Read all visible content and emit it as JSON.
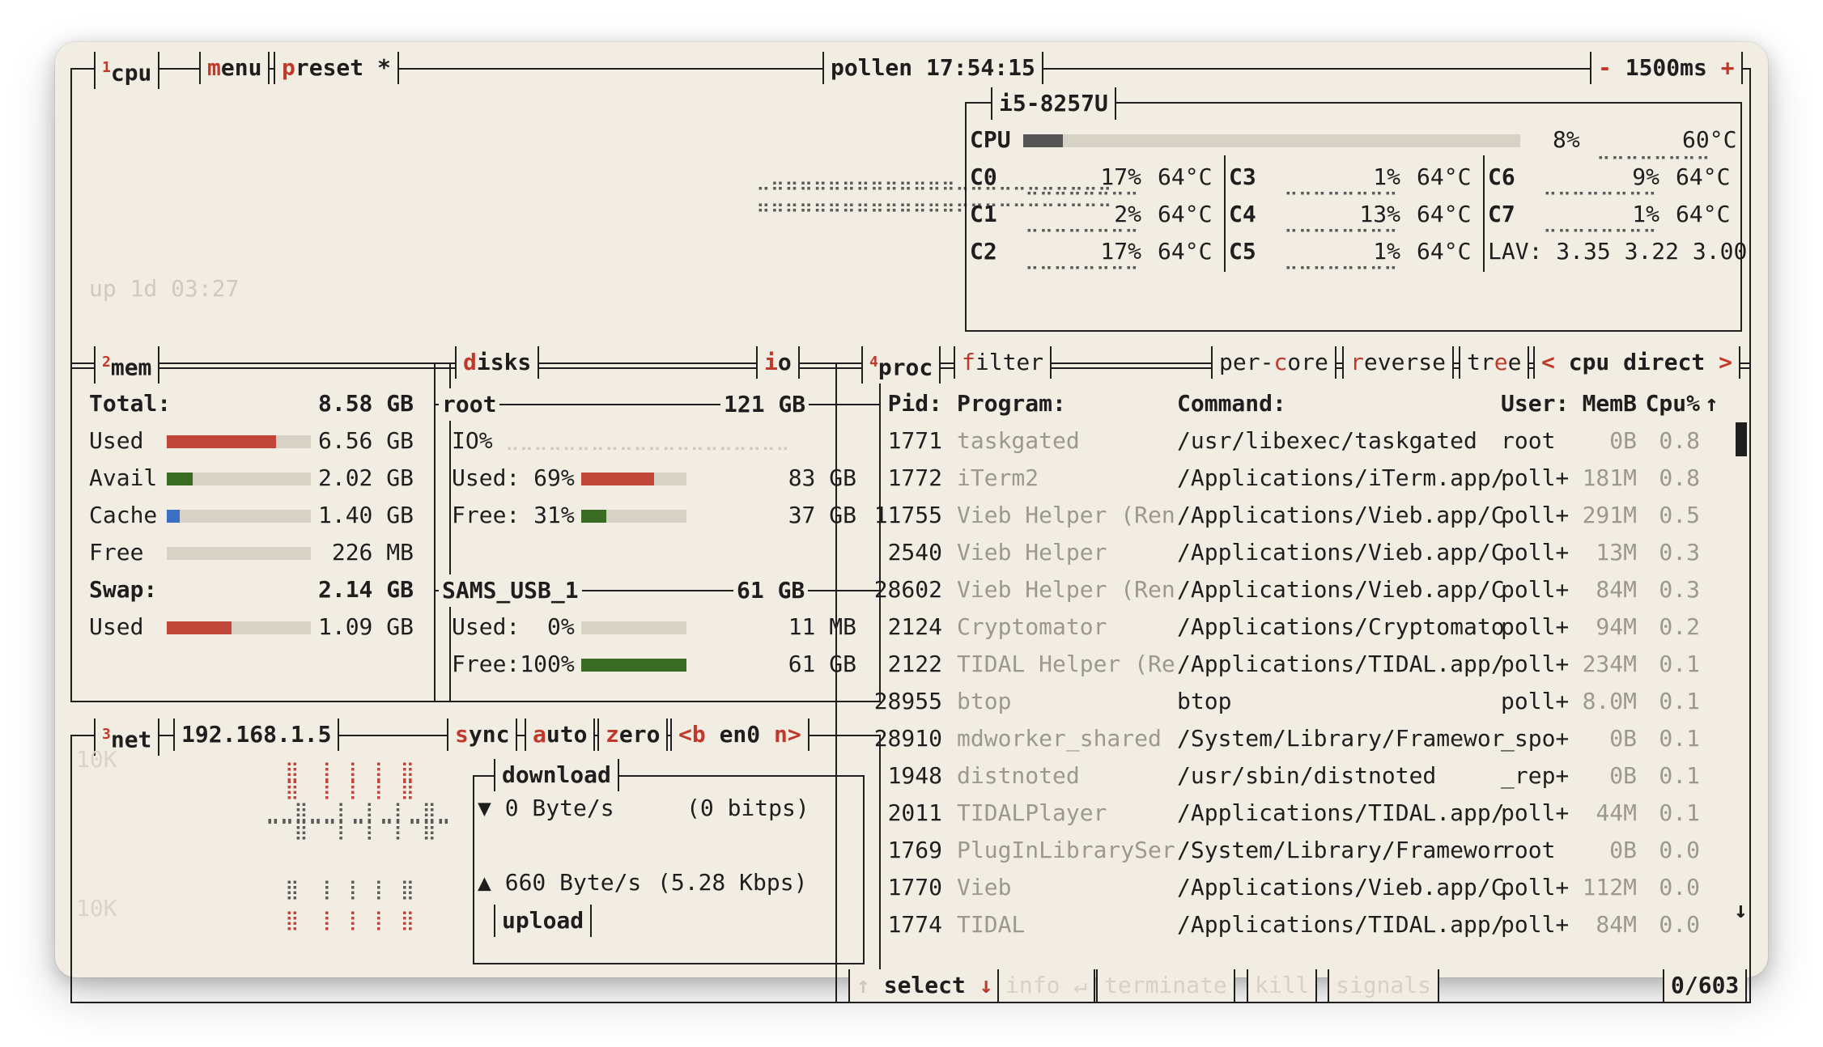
{
  "header": {
    "cpu_label": "cpu",
    "cpu_num": "1",
    "menu_label": "menu",
    "preset_label": "preset *",
    "title": "pollen 17:54:15",
    "interval_minus": "-",
    "interval": "1500ms",
    "interval_plus": "+"
  },
  "cpu": {
    "model": "i5-8257U",
    "total_label": "CPU",
    "total_pct": "8%",
    "total_temp": "60°C",
    "total_frac": 0.08,
    "cores": [
      {
        "name": "C0",
        "pct": "17%",
        "temp": "64°C"
      },
      {
        "name": "C1",
        "pct": "2%",
        "temp": "64°C"
      },
      {
        "name": "C2",
        "pct": "17%",
        "temp": "64°C"
      },
      {
        "name": "C3",
        "pct": "1%",
        "temp": "64°C"
      },
      {
        "name": "C4",
        "pct": "13%",
        "temp": "64°C"
      },
      {
        "name": "C5",
        "pct": "1%",
        "temp": "64°C"
      },
      {
        "name": "C6",
        "pct": "9%",
        "temp": "64°C"
      },
      {
        "name": "C7",
        "pct": "1%",
        "temp": "64°C"
      }
    ],
    "lav_label": "LAV:",
    "lav": "3.35 3.22 3.00",
    "uptime": "up 1d 03:27"
  },
  "mem": {
    "num": "2",
    "title": "mem",
    "total_label": "Total:",
    "total": "8.58 GB",
    "rows": [
      {
        "label": "Used",
        "value": "6.56 GB",
        "frac": 0.76,
        "color": "#c0463a"
      },
      {
        "label": "Avail",
        "value": "2.02 GB",
        "frac": 0.18,
        "color": "#3a6b22"
      },
      {
        "label": "Cache",
        "value": "1.40 GB",
        "frac": 0.09,
        "color": "#3a6fc4"
      },
      {
        "label": "Free",
        "value": "226 MB",
        "frac": 0.0,
        "color": "#3a6b22"
      }
    ],
    "swap_label": "Swap:",
    "swap_total": "2.14 GB",
    "swap_used_label": "Used",
    "swap_used": "1.09 GB",
    "swap_frac": 0.45
  },
  "disks": {
    "title": "disks",
    "io_label": "io",
    "root": {
      "name": "root",
      "size": "121 GB",
      "io": "IO%",
      "used_label": "Used:",
      "used_pct": "69%",
      "used": "83 GB",
      "used_frac": 0.69,
      "free_label": "Free:",
      "free_pct": "31%",
      "free": "37 GB",
      "free_frac": 0.24
    },
    "usb": {
      "name": "SAMS_USB_1",
      "size": "61 GB",
      "used_label": "Used:",
      "used_pct": "0%",
      "used": "11 MB",
      "used_frac": 0.0,
      "free_label": "Free:",
      "free_pct": "100%",
      "free": "61 GB",
      "free_frac": 1.0
    }
  },
  "net": {
    "num": "3",
    "title": "net",
    "ip": "192.168.1.5",
    "sync": "sync",
    "auto": "auto",
    "zero": "zero",
    "iface_prev": "<b",
    "iface": "en0",
    "iface_next": "n>",
    "scale_top": "10K",
    "scale_bottom": "10K",
    "download_label": "download",
    "download": "▼ 0 Byte/s",
    "download_bits": "(0 bitps)",
    "upload": "▲ 660 Byte/s",
    "upload_bits": "(5.28 Kbps)",
    "upload_label": "upload"
  },
  "proc": {
    "num": "4",
    "title": "proc",
    "filter": "filter",
    "per_core": "per-core",
    "reverse": "reverse",
    "tree": "tree",
    "sort_prev": "<",
    "sort": "cpu direct",
    "sort_next": ">",
    "columns": {
      "pid": "Pid:",
      "program": "Program:",
      "command": "Command:",
      "user": "User:",
      "mem": "MemB",
      "cpu": "Cpu%"
    },
    "rows": [
      {
        "pid": "1771",
        "program": "taskgated",
        "command": "/usr/libexec/taskgated",
        "user": "root",
        "mem": "0B",
        "cpu": "0.8"
      },
      {
        "pid": "1772",
        "program": "iTerm2",
        "command": "/Applications/iTerm.app/",
        "user": "poll+",
        "mem": "181M",
        "cpu": "0.8"
      },
      {
        "pid": "11755",
        "program": "Vieb Helper (Ren",
        "command": "/Applications/Vieb.app/C",
        "user": "poll+",
        "mem": "291M",
        "cpu": "0.5"
      },
      {
        "pid": "2540",
        "program": "Vieb Helper",
        "command": "/Applications/Vieb.app/C",
        "user": "poll+",
        "mem": "13M",
        "cpu": "0.3"
      },
      {
        "pid": "28602",
        "program": "Vieb Helper (Ren",
        "command": "/Applications/Vieb.app/C",
        "user": "poll+",
        "mem": "84M",
        "cpu": "0.3"
      },
      {
        "pid": "2124",
        "program": "Cryptomator",
        "command": "/Applications/Cryptomato",
        "user": "poll+",
        "mem": "94M",
        "cpu": "0.2"
      },
      {
        "pid": "2122",
        "program": "TIDAL Helper (Re",
        "command": "/Applications/TIDAL.app/",
        "user": "poll+",
        "mem": "234M",
        "cpu": "0.1"
      },
      {
        "pid": "28955",
        "program": "btop",
        "command": "btop",
        "user": "poll+",
        "mem": "8.0M",
        "cpu": "0.1"
      },
      {
        "pid": "28910",
        "program": "mdworker_shared",
        "command": "/System/Library/Framewor",
        "user": "_spo+",
        "mem": "0B",
        "cpu": "0.1"
      },
      {
        "pid": "1948",
        "program": "distnoted",
        "command": "/usr/sbin/distnoted",
        "user": "_rep+",
        "mem": "0B",
        "cpu": "0.1"
      },
      {
        "pid": "2011",
        "program": "TIDALPlayer",
        "command": "/Applications/TIDAL.app/",
        "user": "poll+",
        "mem": "44M",
        "cpu": "0.1"
      },
      {
        "pid": "1769",
        "program": "PlugInLibrarySer",
        "command": "/System/Library/Framewor",
        "user": "root",
        "mem": "0B",
        "cpu": "0.0"
      },
      {
        "pid": "1770",
        "program": "Vieb",
        "command": "/Applications/Vieb.app/C",
        "user": "poll+",
        "mem": "112M",
        "cpu": "0.0"
      },
      {
        "pid": "1774",
        "program": "TIDAL",
        "command": "/Applications/TIDAL.app/",
        "user": "poll+",
        "mem": "84M",
        "cpu": "0.0"
      }
    ],
    "footer": {
      "select": "select",
      "info": "info",
      "terminate": "terminate",
      "kill": "kill",
      "signals": "signals",
      "count": "0/603"
    }
  }
}
